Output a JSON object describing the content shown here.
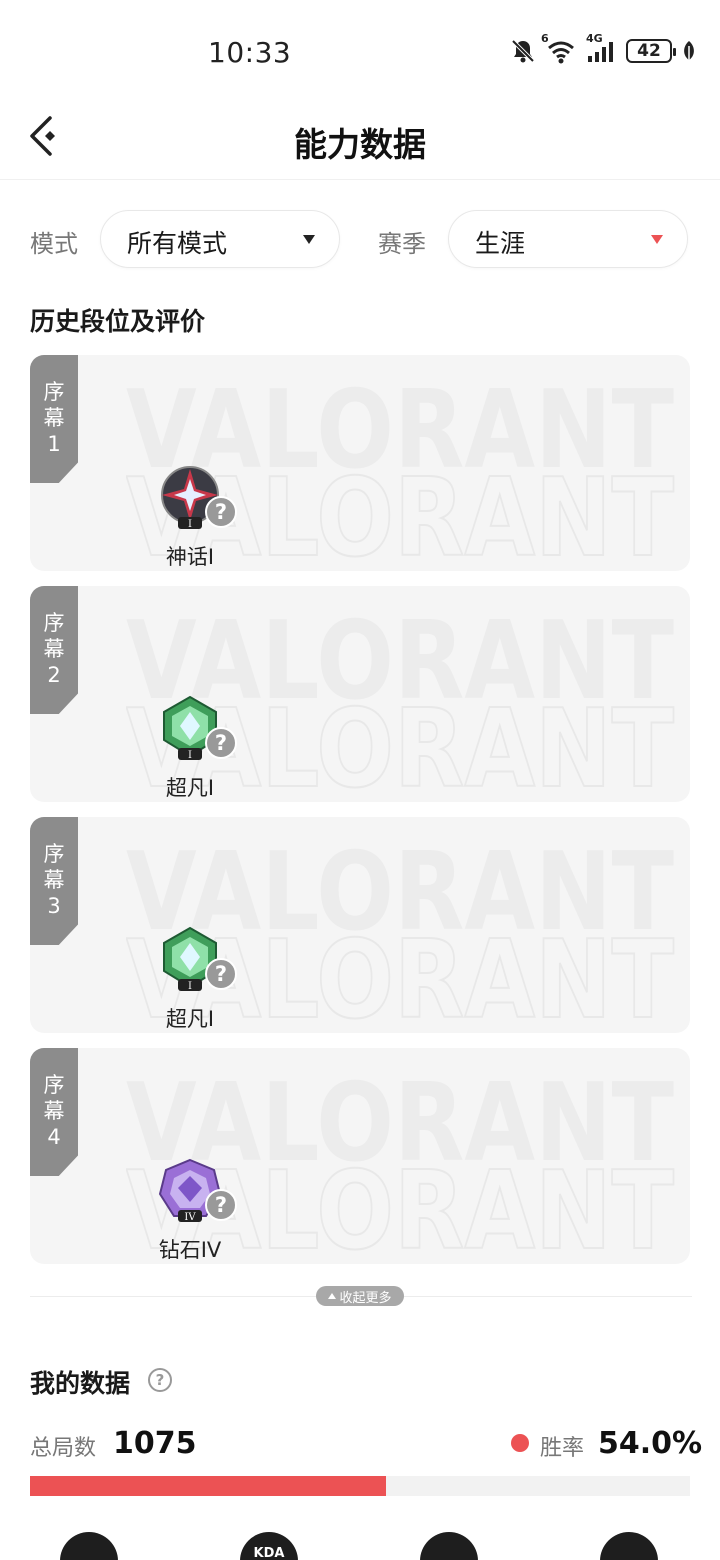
{
  "status_bar": {
    "time": "10:33",
    "battery": "42",
    "network": "4G",
    "wifi_badge": "6"
  },
  "header": {
    "title": "能力数据",
    "back_icon": "back-arrow-icon"
  },
  "filters": {
    "mode_label": "模式",
    "mode_value": "所有模式",
    "season_label": "赛季",
    "season_value": "生涯",
    "season_arrow_color": "#ec5254"
  },
  "history": {
    "title": "历史段位及评价",
    "watermark_text": "VALORANT",
    "seasons": [
      {
        "tag_chars": [
          "序",
          "幕",
          "1"
        ],
        "rank": "神话I",
        "badge": "mythic-rank-icon",
        "badge_numeral": "I",
        "badge_color": "#c8384a"
      },
      {
        "tag_chars": [
          "序",
          "幕",
          "2"
        ],
        "rank": "超凡I",
        "badge": "transcendent-rank-icon",
        "badge_numeral": "I",
        "badge_color": "#3f9e5a"
      },
      {
        "tag_chars": [
          "序",
          "幕",
          "3"
        ],
        "rank": "超凡I",
        "badge": "transcendent-rank-icon",
        "badge_numeral": "I",
        "badge_color": "#3f9e5a"
      },
      {
        "tag_chars": [
          "序",
          "幕",
          "4"
        ],
        "rank": "钻石IV",
        "badge": "diamond-rank-icon",
        "badge_numeral": "IV",
        "badge_color": "#9a6fd6"
      }
    ],
    "collapse_label": "收起更多"
  },
  "my_data": {
    "title": "我的数据",
    "total_games_label": "总局数",
    "total_games": "1075",
    "win_rate_label": "胜率",
    "win_rate": "54.0%",
    "win_rate_fraction": 0.54,
    "accent_color": "#ec5254",
    "bottom_icons": [
      {
        "icon": "star-shield-icon",
        "text": ""
      },
      {
        "icon": "kda-icon",
        "text": "KDA"
      },
      {
        "icon": "crosshair-icon",
        "text": ""
      },
      {
        "icon": "gauge-icon",
        "text": ""
      }
    ]
  }
}
